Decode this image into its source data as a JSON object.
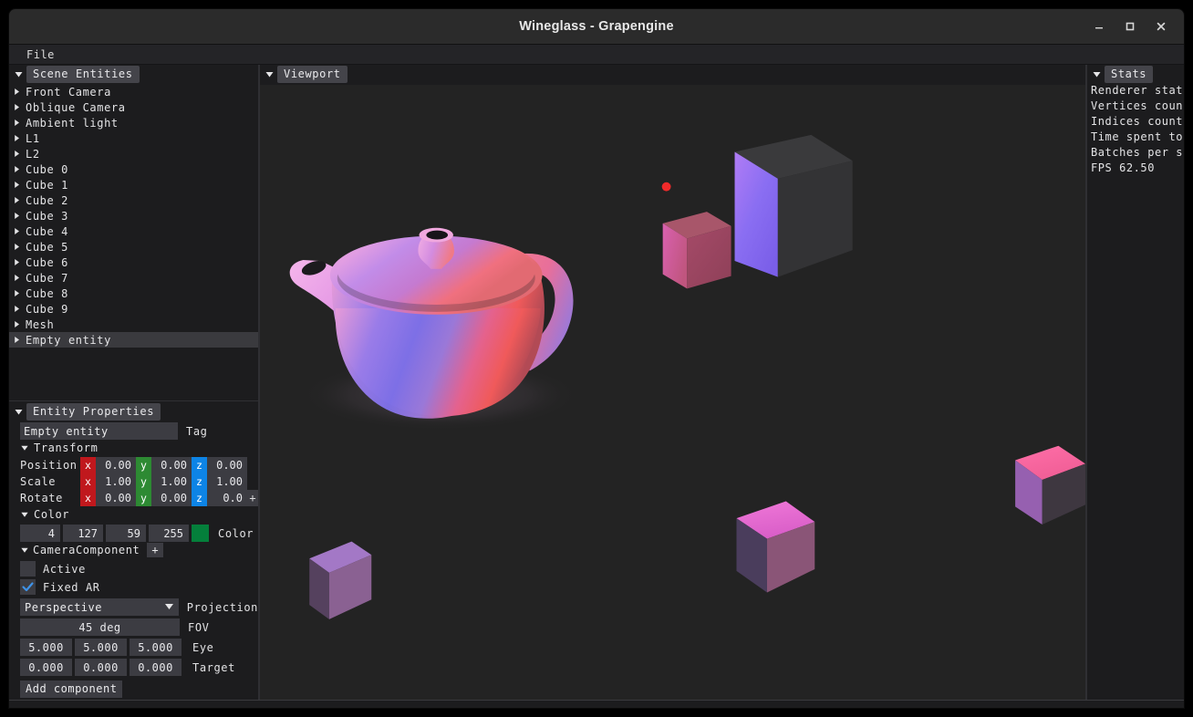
{
  "window": {
    "title": "Wineglass - Grapengine",
    "minimize_label": "minimize",
    "maximize_label": "maximize",
    "close_label": "close"
  },
  "menu": {
    "items": [
      {
        "label": "File"
      }
    ]
  },
  "scene_panel": {
    "title": "Scene Entities",
    "entities": [
      {
        "label": "Front Camera",
        "selected": false
      },
      {
        "label": "Oblique Camera",
        "selected": false
      },
      {
        "label": "Ambient light",
        "selected": false
      },
      {
        "label": "L1",
        "selected": false
      },
      {
        "label": "L2",
        "selected": false
      },
      {
        "label": "Cube 0",
        "selected": false
      },
      {
        "label": "Cube 1",
        "selected": false
      },
      {
        "label": "Cube 2",
        "selected": false
      },
      {
        "label": "Cube 3",
        "selected": false
      },
      {
        "label": "Cube 4",
        "selected": false
      },
      {
        "label": "Cube 5",
        "selected": false
      },
      {
        "label": "Cube 6",
        "selected": false
      },
      {
        "label": "Cube 7",
        "selected": false
      },
      {
        "label": "Cube 8",
        "selected": false
      },
      {
        "label": "Cube 9",
        "selected": false
      },
      {
        "label": "Mesh",
        "selected": false
      },
      {
        "label": "Empty entity",
        "selected": true
      }
    ]
  },
  "properties_panel": {
    "title": "Entity Properties",
    "name_value": "Empty entity",
    "name_label": "Tag",
    "transform": {
      "title": "Transform",
      "rows": [
        {
          "label": "Position",
          "x": "0.00",
          "y": "0.00",
          "z": "0.00"
        },
        {
          "label": "Scale",
          "x": "1.00",
          "y": "1.00",
          "z": "1.00"
        },
        {
          "label": "Rotate",
          "x": "0.00",
          "y": "0.00",
          "z": "0.0"
        }
      ],
      "axis_x": "x",
      "axis_y": "y",
      "axis_z": "z",
      "plus_label": "+"
    },
    "color": {
      "title": "Color",
      "r": "4",
      "g": "127",
      "b": "59",
      "a": "255",
      "label": "Color",
      "swatch_hex": "#047f3b"
    },
    "camera_component": {
      "title": "CameraComponent",
      "add_label": "+",
      "active_label": "Active",
      "active_checked": false,
      "fixed_ar_label": "Fixed AR",
      "fixed_ar_checked": true,
      "projection_value": "Perspective",
      "projection_label": "Projection",
      "fov_value": "45 deg",
      "fov_label": "FOV",
      "eye": [
        "5.000",
        "5.000",
        "5.000"
      ],
      "eye_label": "Eye",
      "target": [
        "0.000",
        "0.000",
        "0.000"
      ],
      "target_label": "Target"
    },
    "add_component_label": "Add component"
  },
  "viewport": {
    "title": "Viewport",
    "background_hex": "#232323"
  },
  "stats_panel": {
    "title": "Stats",
    "lines": [
      "Renderer stat",
      "Vertices coun",
      "Indices count",
      "Time spent to",
      "Batches per s",
      "FPS 62.50"
    ]
  },
  "accent_colors": {
    "axis_x": "#c0181d",
    "axis_y": "#2d8a33",
    "axis_z": "#0d84e6",
    "checkbox_check": "#3f93e8",
    "selection": "#3a3a3e"
  }
}
